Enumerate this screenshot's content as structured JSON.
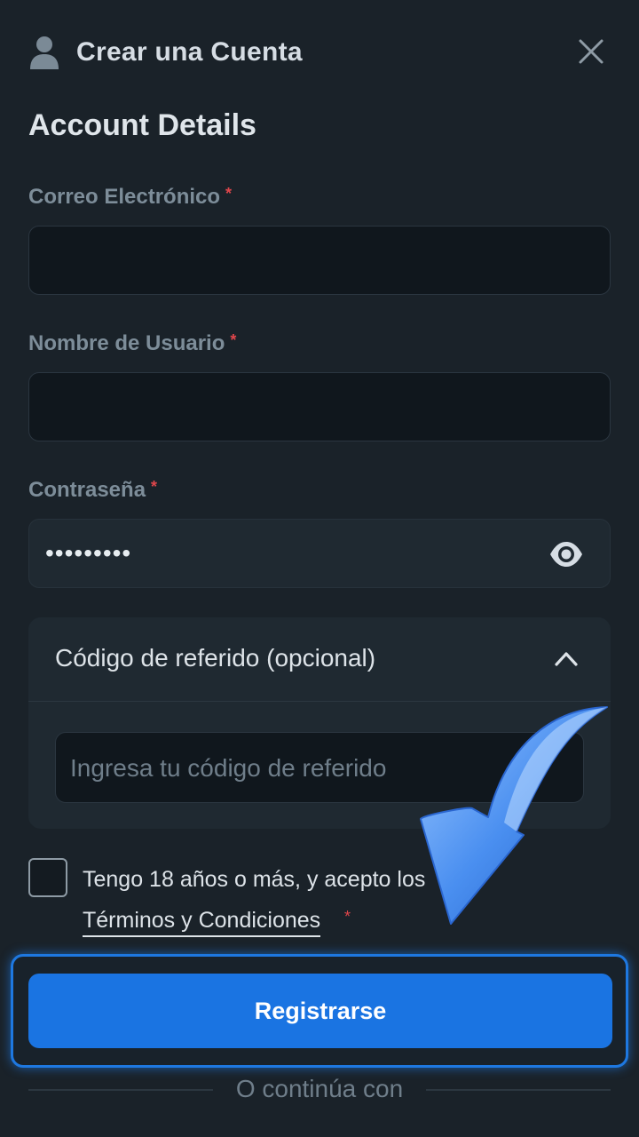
{
  "header": {
    "title": "Crear una Cuenta"
  },
  "section": {
    "title": "Account Details"
  },
  "fields": {
    "email": {
      "label": "Correo Electrónico",
      "required_mark": "*",
      "value": ""
    },
    "username": {
      "label": "Nombre de Usuario",
      "required_mark": "*",
      "value": ""
    },
    "password": {
      "label": "Contraseña",
      "required_mark": "*",
      "masked_value": "•••••••••"
    }
  },
  "referral": {
    "title": "Código de referido (opcional)",
    "placeholder": "Ingresa tu código de referido",
    "expanded": true
  },
  "terms": {
    "text": "Tengo 18 años o más, y acepto los",
    "link": "Términos y Condiciones",
    "required_mark": "*",
    "checked": false
  },
  "actions": {
    "register_label": "Registrarse"
  },
  "footer": {
    "continue_text": "O continúa con"
  },
  "colors": {
    "background": "#1a2229",
    "primary": "#1a74e2",
    "required": "#e0464b",
    "label": "#7d8d99"
  }
}
